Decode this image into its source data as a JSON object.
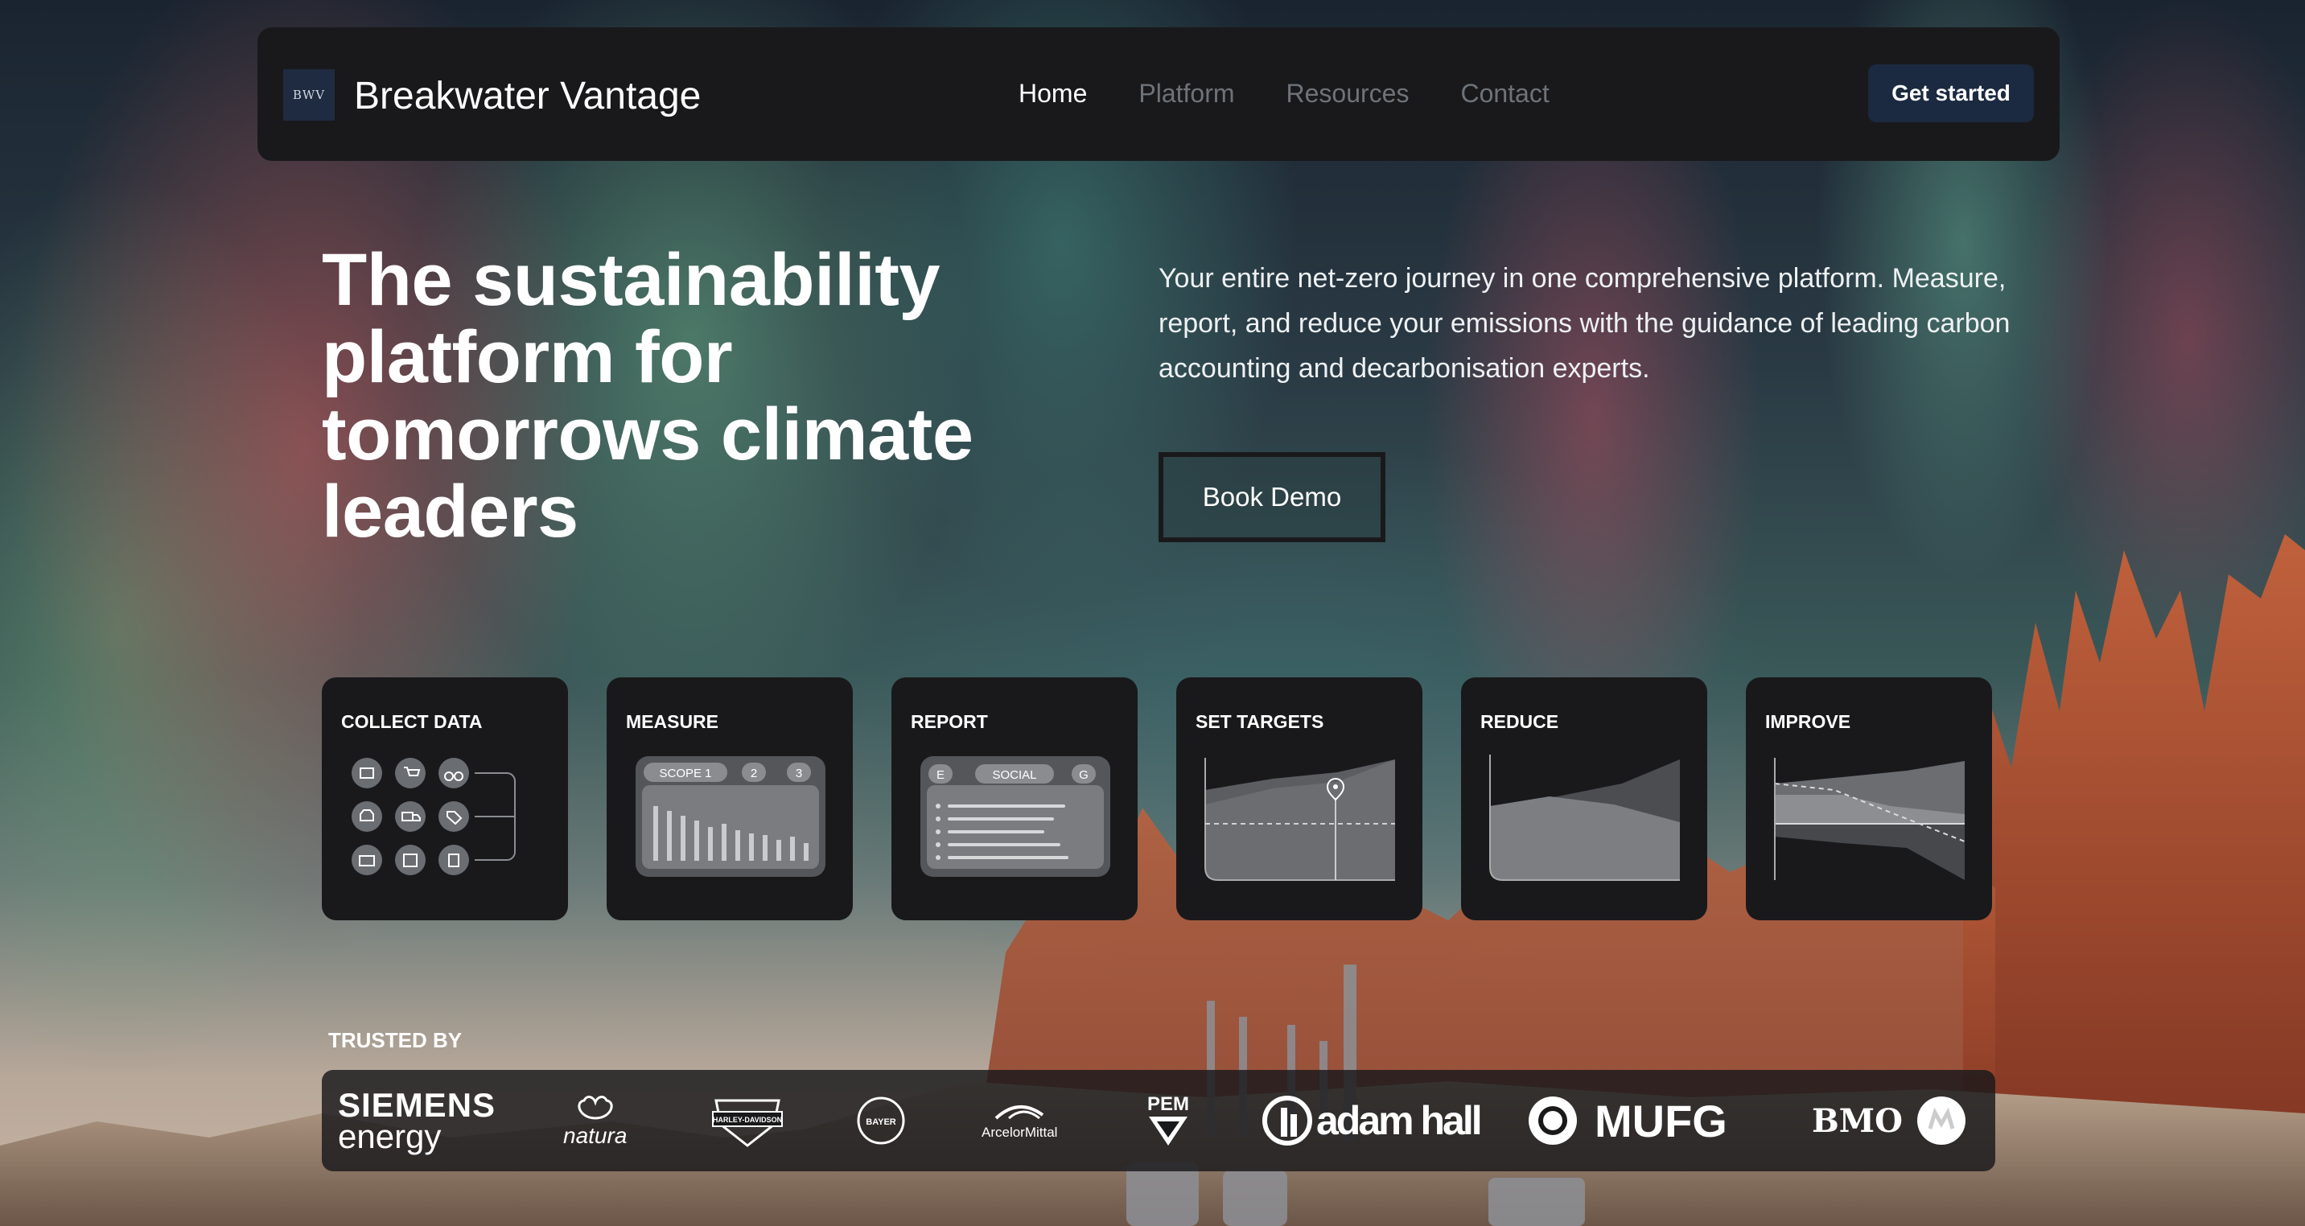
{
  "nav": {
    "logo_badge": "BWV",
    "brand": "Breakwater Vantage",
    "links": [
      "Home",
      "Platform",
      "Resources",
      "Contact"
    ],
    "active_link": "Home",
    "cta": "Get started"
  },
  "hero": {
    "title": "The sustainability platform for tomorrows climate leaders",
    "description": "Your entire net-zero journey in one comprehensive platform. Measure, report, and reduce your emissions with the guidance of leading carbon accounting and decarbonisation experts.",
    "button": "Book Demo"
  },
  "steps": [
    {
      "title": "COLLECT DATA"
    },
    {
      "title": "MEASURE",
      "chips": [
        "SCOPE 1",
        "2",
        "3"
      ]
    },
    {
      "title": "REPORT",
      "chips": [
        "E",
        "SOCIAL",
        "G"
      ]
    },
    {
      "title": "SET TARGETS"
    },
    {
      "title": "REDUCE"
    },
    {
      "title": "IMPROVE"
    }
  ],
  "trusted": {
    "label": "TRUSTED BY",
    "logos": [
      {
        "name": "siemens-energy-logo",
        "line1": "SIEMENS",
        "line2": "energy"
      },
      {
        "name": "natura-logo",
        "text": "natura"
      },
      {
        "name": "harley-davidson-logo",
        "text": "HARLEY-DAVIDSON"
      },
      {
        "name": "bayer-logo",
        "text": "BAYER"
      },
      {
        "name": "arcelormittal-logo",
        "text": "ArcelorMittal"
      },
      {
        "name": "pem-logo",
        "text": "PEM"
      },
      {
        "name": "adam-hall-logo",
        "text": "adam hall"
      },
      {
        "name": "mufg-logo",
        "text": "MUFG"
      },
      {
        "name": "bmo-logo",
        "text": "BMO"
      }
    ]
  },
  "colors": {
    "panel": "#19191b",
    "accent_button": "#1b2a40",
    "nav_inactive": "#6e737a"
  }
}
